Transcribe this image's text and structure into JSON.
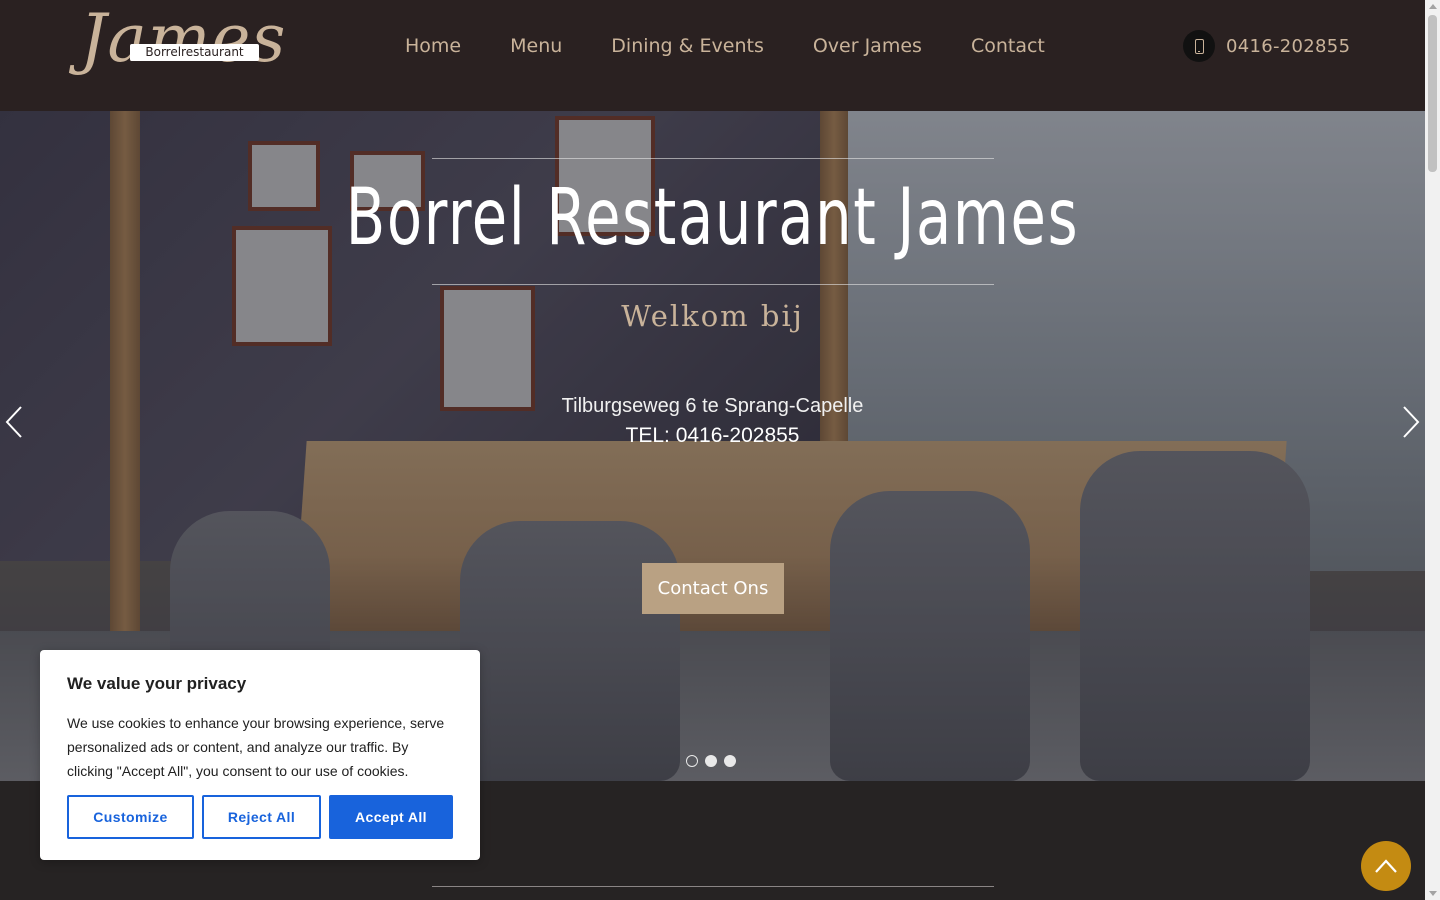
{
  "header": {
    "logo_script": "James",
    "logo_badge": "Borrelrestaurant",
    "nav": [
      {
        "label": "Home"
      },
      {
        "label": "Menu"
      },
      {
        "label": "Dining & Events"
      },
      {
        "label": "Over James"
      },
      {
        "label": "Contact"
      }
    ],
    "phone_icon": "mobile-phone-icon",
    "phone": "0416-202855"
  },
  "hero": {
    "title": "Borrel Restaurant James",
    "subtitle": "Welkom bij",
    "address": "Tilburgseweg 6  te Sprang-Capelle",
    "tel": "TEL: 0416-202855",
    "cta_label": "Contact Ons",
    "prev_icon": "chevron-left-icon",
    "next_icon": "chevron-right-icon",
    "slides_count": 3,
    "active_slide": 1
  },
  "cookie": {
    "title": "We value your privacy",
    "body": "We use cookies to enhance your browsing experience, serve personalized ads or content, and analyze our traffic. By clicking \"Accept All\", you consent to our use of cookies.",
    "customize": "Customize",
    "reject": "Reject All",
    "accept": "Accept All"
  },
  "colors": {
    "header_bg": "#2a2121",
    "accent": "#c9b39a",
    "cta": "#b9a183",
    "cookie_blue": "#1863dc",
    "totop": "#c48b12"
  },
  "totop_icon": "chevron-up-icon"
}
